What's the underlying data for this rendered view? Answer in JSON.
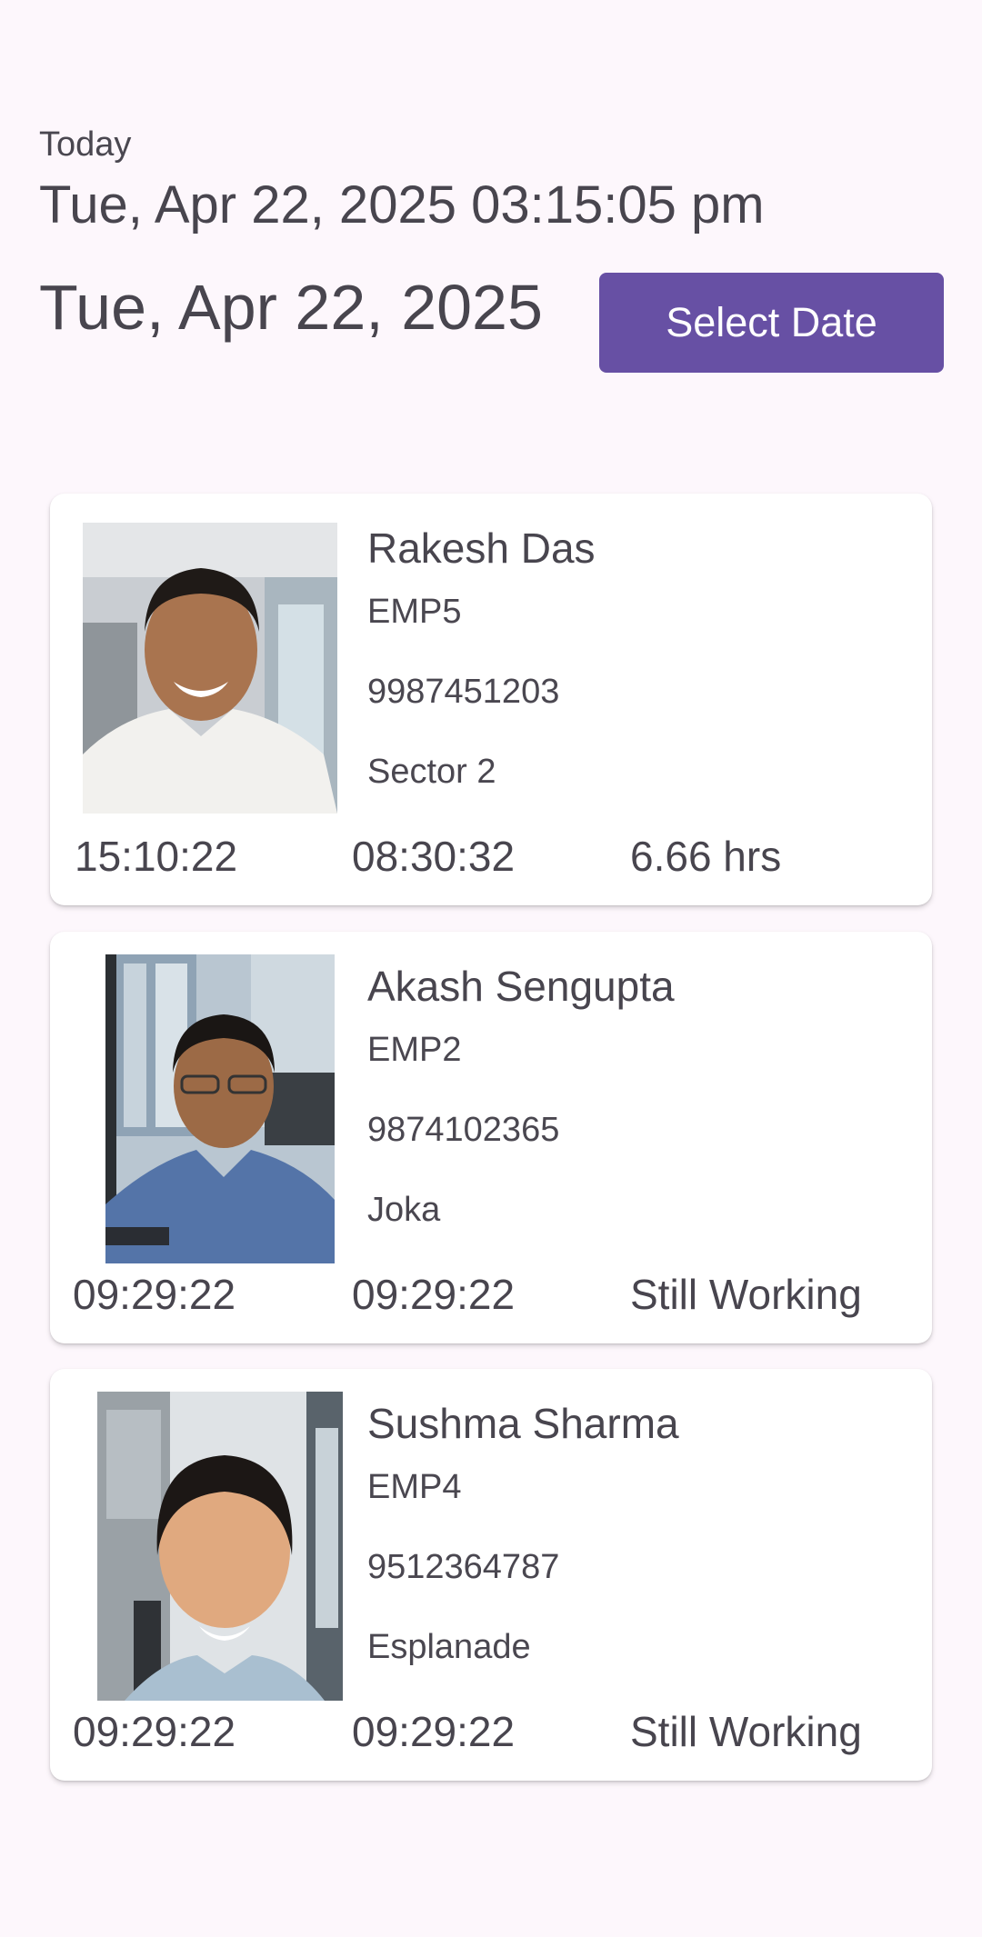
{
  "header": {
    "today_label": "Today",
    "current_datetime": "Tue, Apr 22, 2025 03:15:05 pm",
    "selected_date": "Tue, Apr 22, 2025",
    "select_date_button": "Select Date"
  },
  "colors": {
    "background": "#fdf7fc",
    "accent": "#6750a4",
    "text": "#48454e"
  },
  "employees": [
    {
      "name": "Rakesh Das",
      "emp_id": "EMP5",
      "phone": "9987451203",
      "location": "Sector 2",
      "in_time": "15:10:22",
      "out_time": "08:30:32",
      "hours": "6.66 hrs"
    },
    {
      "name": "Akash Sengupta",
      "emp_id": "EMP2",
      "phone": "9874102365",
      "location": "Joka",
      "in_time": "09:29:22",
      "out_time": "09:29:22",
      "hours": "Still Working"
    },
    {
      "name": "Sushma Sharma",
      "emp_id": "EMP4",
      "phone": "9512364787",
      "location": "Esplanade",
      "in_time": "09:29:22",
      "out_time": "09:29:22",
      "hours": "Still Working"
    }
  ]
}
